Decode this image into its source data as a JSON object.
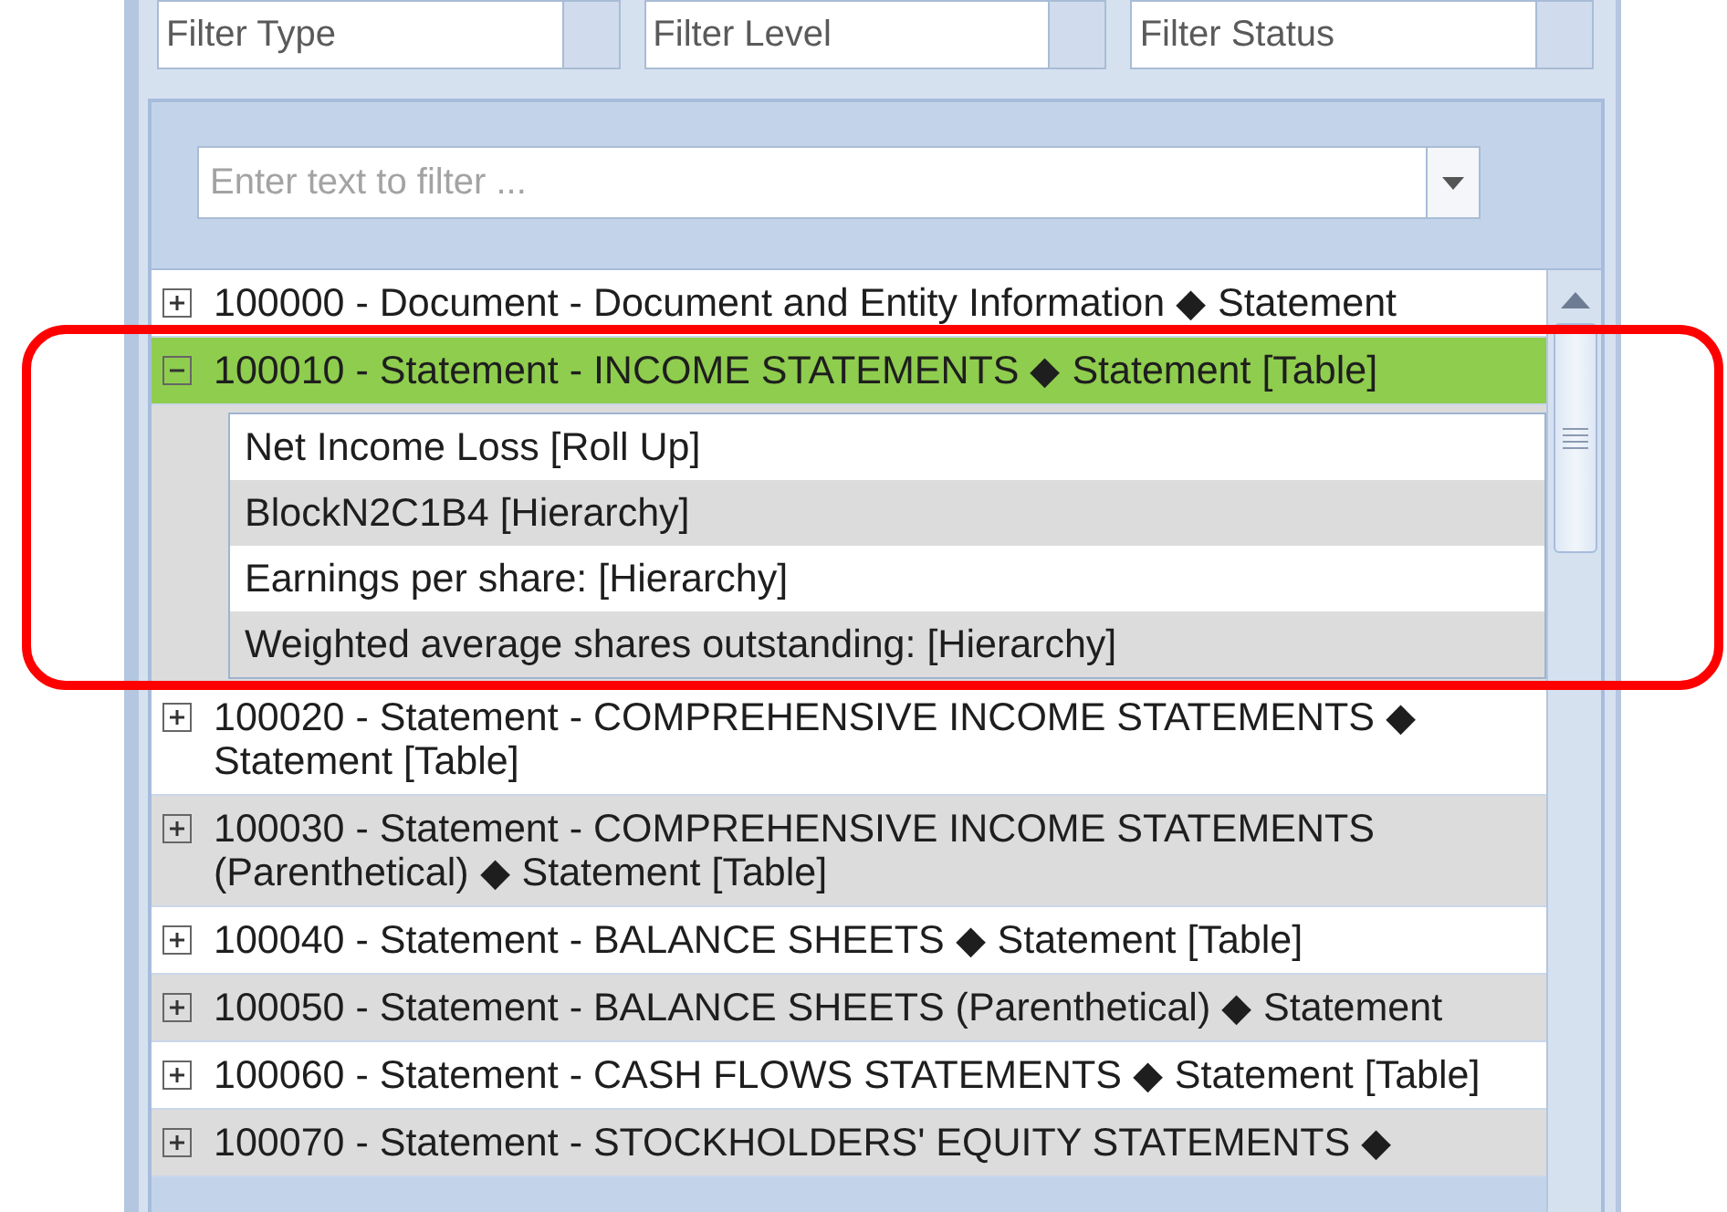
{
  "filters": [
    {
      "placeholder": "Filter Type"
    },
    {
      "placeholder": "Filter Level"
    },
    {
      "placeholder": "Filter Status"
    }
  ],
  "search": {
    "placeholder": "Enter text to filter ..."
  },
  "tree": {
    "items": [
      {
        "label": "100000 - Document - Document and Entity Information ◆ Statement",
        "expanded": false,
        "selected": false
      },
      {
        "label": "100010 - Statement - INCOME STATEMENTS ◆ Statement [Table]",
        "expanded": true,
        "selected": true,
        "children": [
          {
            "label": "Net Income Loss [Roll Up]"
          },
          {
            "label": "BlockN2C1B4 [Hierarchy]"
          },
          {
            "label": "Earnings per share: [Hierarchy]"
          },
          {
            "label": "Weighted average shares outstanding: [Hierarchy]"
          }
        ]
      },
      {
        "label": "100020 - Statement - COMPREHENSIVE INCOME STATEMENTS ◆ Statement [Table]",
        "expanded": false,
        "selected": false
      },
      {
        "label": "100030 - Statement - COMPREHENSIVE INCOME STATEMENTS (Parenthetical) ◆ Statement [Table]",
        "expanded": false,
        "selected": false
      },
      {
        "label": "100040 - Statement - BALANCE SHEETS ◆ Statement [Table]",
        "expanded": false,
        "selected": false
      },
      {
        "label": "100050 - Statement - BALANCE SHEETS (Parenthetical) ◆ Statement",
        "expanded": false,
        "selected": false
      },
      {
        "label": "100060 - Statement - CASH FLOWS STATEMENTS ◆ Statement [Table]",
        "expanded": false,
        "selected": false
      },
      {
        "label": "100070 - Statement - STOCKHOLDERS' EQUITY STATEMENTS ◆",
        "expanded": false,
        "selected": false
      }
    ]
  }
}
